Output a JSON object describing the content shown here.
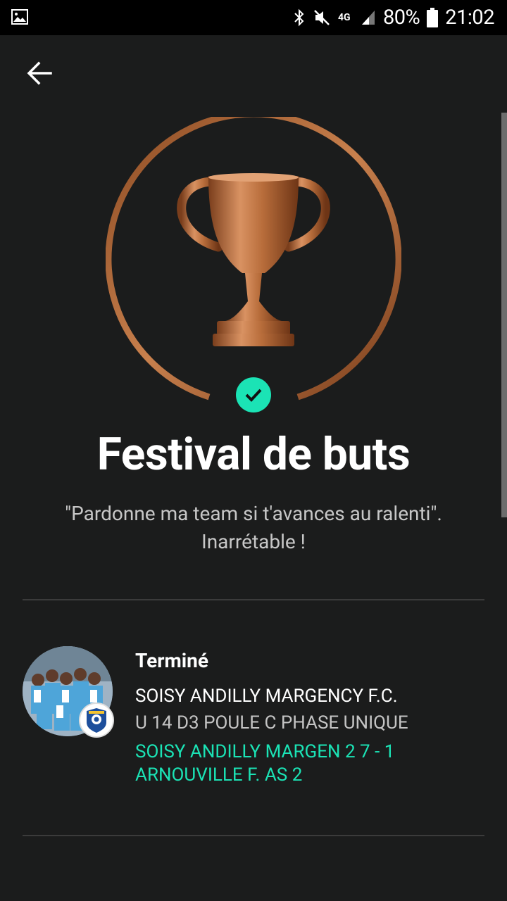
{
  "statusbar": {
    "image_icon": "gallery-image-icon",
    "bluetooth_icon": "bluetooth-icon",
    "mute_icon": "mute-icon",
    "network_label": "4G",
    "signal_icon": "signal-icon",
    "battery_text": "80%",
    "battery_icon": "battery-icon",
    "time": "21:02"
  },
  "header": {
    "back_icon": "arrow-left-icon"
  },
  "achievement": {
    "title": "Festival de buts",
    "quote": "\"Pardonne ma team si t'avances au ralenti\". Inarrétable !",
    "completed_icon": "check-icon",
    "ring_color": "#b56a35",
    "trophy_color": "#c27a44"
  },
  "match": {
    "status": "Terminé",
    "team": "SOISY ANDILLY MARGENCY F.C.",
    "league": "U 14 D3 POULE C PHASE UNIQUE",
    "score_line": "SOISY ANDILLY MARGEN 2 7 - 1 ARNOUVILLE F. AS 2",
    "accent_color": "#1be3b5"
  }
}
